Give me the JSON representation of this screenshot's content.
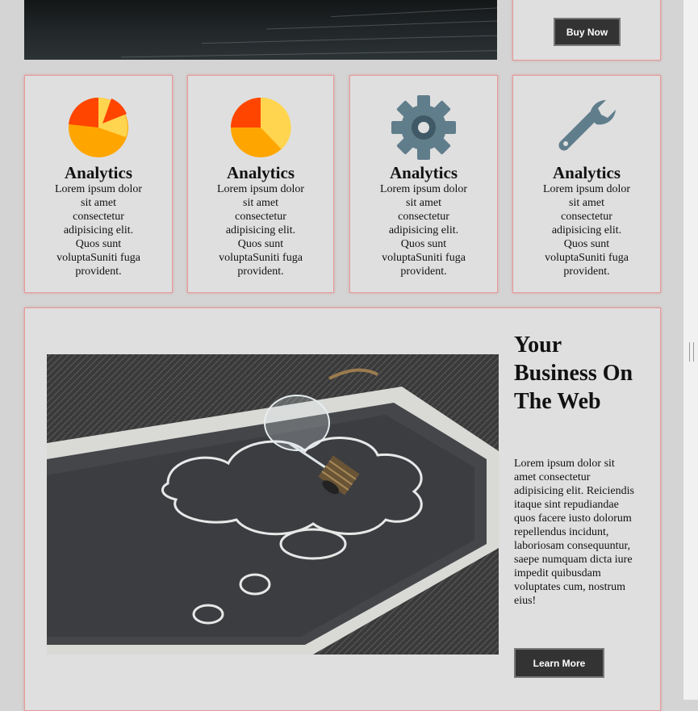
{
  "top_card": {
    "buy_button_label": "Buy Now"
  },
  "features": [
    {
      "icon": "pie-chart-icon",
      "title": "Analytics",
      "text": "Lorem ipsum dolor sit amet consectetur adipisicing elit. Quos sunt voluptaSuniti fuga provident."
    },
    {
      "icon": "pie-chart-icon",
      "title": "Analytics",
      "text": "Lorem ipsum dolor sit amet consectetur adipisicing elit. Quos sunt voluptaSuniti fuga provident."
    },
    {
      "icon": "gear-icon",
      "title": "Analytics",
      "text": "Lorem ipsum dolor sit amet consectetur adipisicing elit. Quos sunt voluptaSuniti fuga provident."
    },
    {
      "icon": "wrench-icon",
      "title": "Analytics",
      "text": "Lorem ipsum dolor sit amet consectetur adipisicing elit. Quos sunt voluptaSuniti fuga provident."
    }
  ],
  "business": {
    "title": "Your Business On The Web",
    "text": "Lorem ipsum dolor sit amet consectetur adipisicing elit. Reiciendis itaque sint repudiandae quos facere iusto dolorum repellendus incidunt, laboriosam consequuntur, saepe numquam dicta iure impedit quibusdam voluptates cum, nostrum eius!",
    "button_label": "Learn More"
  },
  "colors": {
    "card_background": "#dfdfdf",
    "card_border": "#e59a9a",
    "button_background": "#333333",
    "page_background": "#d4d4d4"
  }
}
